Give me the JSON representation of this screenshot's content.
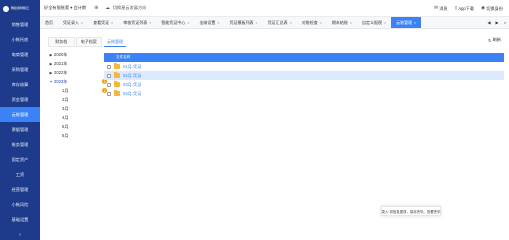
{
  "sidebar": {
    "logo_text": "畅捷通财税云",
    "items": [
      {
        "label": "销售管理"
      },
      {
        "label": "小帐托底"
      },
      {
        "label": "电商管理"
      },
      {
        "label": "采购管理"
      },
      {
        "label": "库存核算"
      },
      {
        "label": "资金管理"
      },
      {
        "label": "云账管理",
        "active": true
      },
      {
        "label": "票据管理"
      },
      {
        "label": "账务管理"
      },
      {
        "label": "固定资产"
      },
      {
        "label": "工资"
      },
      {
        "label": "经营管理"
      },
      {
        "label": "小帐风险"
      },
      {
        "label": "基础设置"
      }
    ],
    "bottom_icon": "chevron-left-icon"
  },
  "topbar": {
    "account_books": "好全有限账套 ▾ 会计期",
    "switch_label": "切换星云发展方向",
    "right_items": [
      {
        "icon": "message-icon",
        "label": "消息"
      },
      {
        "icon": "mobile-icon",
        "label": "App下载"
      },
      {
        "icon": "user-icon",
        "label": "切换身份"
      }
    ]
  },
  "tabs": [
    {
      "label": "首页",
      "closable": false
    },
    {
      "label": "凭证录入",
      "closable": true
    },
    {
      "label": "查看凭证",
      "closable": true
    },
    {
      "label": "审核凭证列表",
      "closable": true
    },
    {
      "label": "智能凭证中心",
      "closable": true
    },
    {
      "label": "出纳设置",
      "closable": true
    },
    {
      "label": "凭证模板列表",
      "closable": true
    },
    {
      "label": "凭证汇总表",
      "closable": true
    },
    {
      "label": "对账检查",
      "closable": true
    },
    {
      "label": "期末结账",
      "closable": true
    },
    {
      "label": "自定义报税",
      "closable": true
    },
    {
      "label": "云账管理",
      "closable": true,
      "active": true
    }
  ],
  "content": {
    "title_tab": "云账管理",
    "refresh_label": "刷新",
    "left_tabs": [
      "财务档",
      "电子档案"
    ],
    "tree": [
      {
        "label": "2020年",
        "expanded": false
      },
      {
        "label": "2021年",
        "expanded": false
      },
      {
        "label": "2022年",
        "expanded": false
      },
      {
        "label": "2023年",
        "expanded": true,
        "badge": "1",
        "children": [
          {
            "label": "1月",
            "badge": "1"
          },
          {
            "label": "2月"
          },
          {
            "label": "3月"
          },
          {
            "label": "4月"
          },
          {
            "label": "5月"
          },
          {
            "label": "6月"
          }
        ]
      }
    ],
    "table_header": "文件名称",
    "rows": [
      {
        "name": "01月.凭证",
        "highlight": false
      },
      {
        "name": "02月.凭证",
        "highlight": true
      },
      {
        "name": "03月.凭证",
        "highlight": false
      },
      {
        "name": "04月.凭证",
        "highlight": false
      }
    ],
    "toast": "录入·将信息更改，保存完毕。查看完毕"
  },
  "colors": {
    "sidebar": "#1e3a8a",
    "accent": "#3b82f6",
    "highlight_row": "#dbeafe",
    "badge": "#f59e0b",
    "folder": "#f5b83d"
  }
}
